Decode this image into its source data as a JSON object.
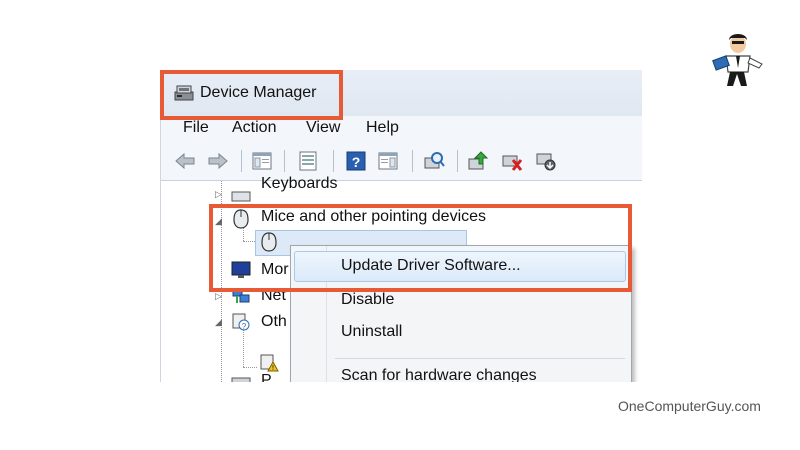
{
  "window": {
    "title": "Device Manager"
  },
  "menu": {
    "items": [
      "File",
      "Action",
      "View",
      "Help"
    ]
  },
  "toolbar": {
    "icons": [
      "back-icon",
      "forward-icon",
      "show-hide-tree-icon",
      "properties-icon",
      "help-icon",
      "action-pane-icon",
      "scan-hardware-icon",
      "update-driver-icon",
      "disable-device-icon",
      "uninstall-device-icon"
    ]
  },
  "tree": {
    "keyboards": "Keyboards",
    "mice": "Mice and other pointing devices",
    "monitors": "Mor",
    "network": "Net",
    "other": "Oth",
    "cut_item": "P"
  },
  "context_menu": {
    "items": [
      "Update Driver Software...",
      "Disable",
      "Uninstall",
      "Scan for hardware changes"
    ]
  },
  "watermark": "OneComputerGuy.com",
  "colors": {
    "highlight_box": "#e85a35",
    "menu_hover": "#dbeaf9"
  }
}
